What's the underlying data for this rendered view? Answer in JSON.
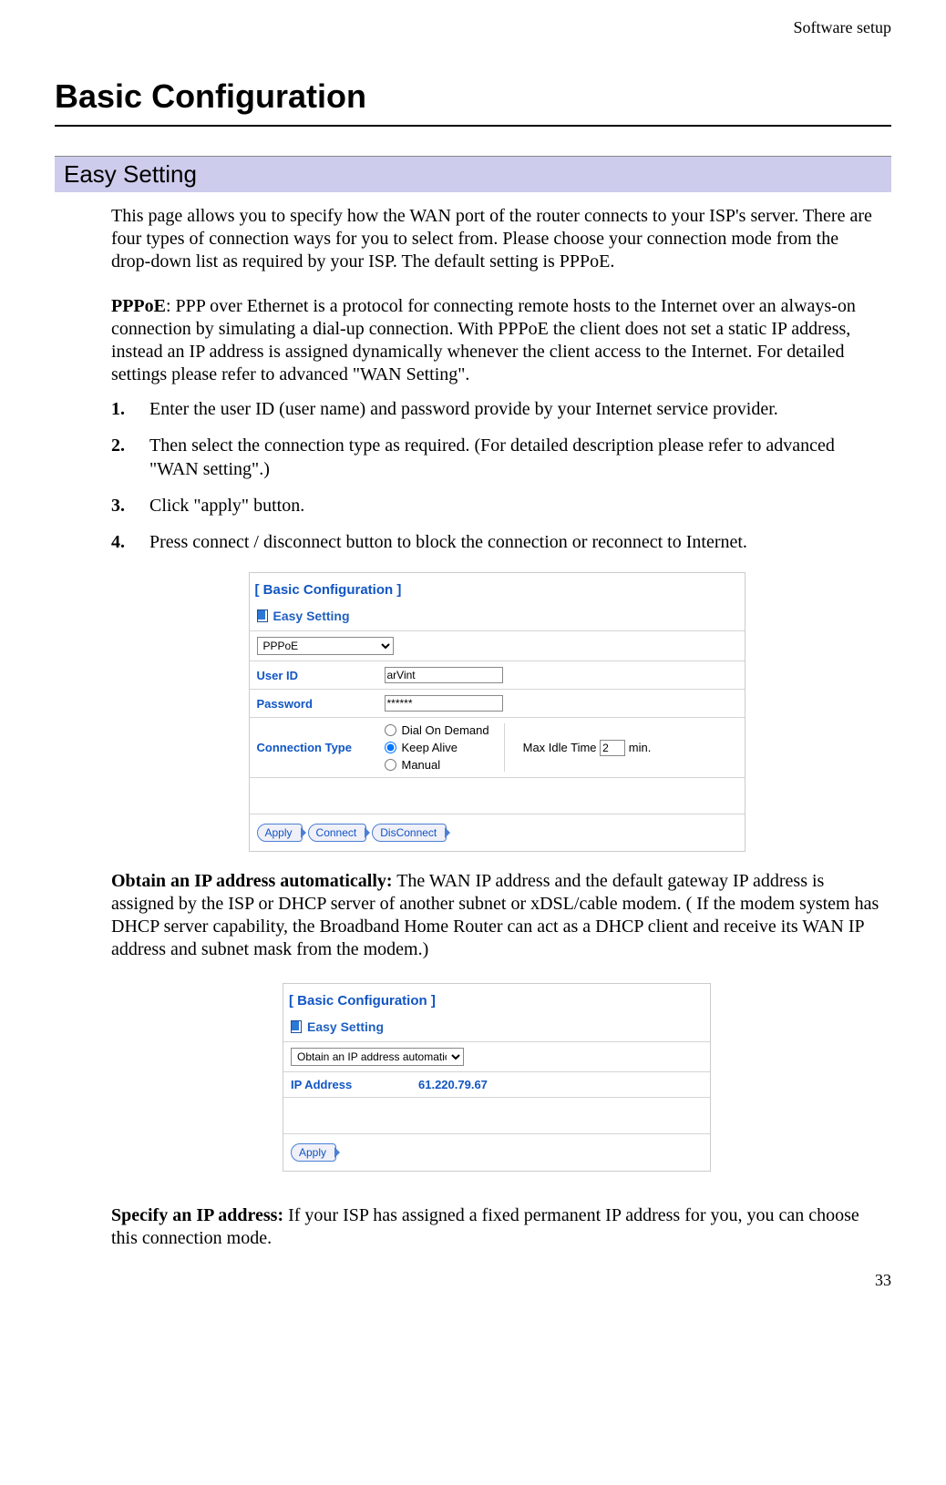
{
  "header": {
    "running_head": "Software setup",
    "title": "Basic Configuration",
    "section": "Easy Setting"
  },
  "intro": "This page allows you to specify how the WAN port of the router connects to your ISP's server. There are four types of connection ways for you to select from. Please choose your connection mode from the drop-down list as required by your ISP. The default setting is PPPoE.",
  "pppoe": {
    "label": "PPPoE",
    "desc": ": PPP over Ethernet is a protocol for connecting remote hosts to the Internet over an always-on connection by simulating a dial-up connection. With PPPoE the client does not set a static IP address, instead an IP address is assigned dynamically whenever the client access to the Internet. For detailed settings please refer to advanced \"WAN Setting\"."
  },
  "steps": [
    "Enter the user ID (user name) and password provide by your Internet service provider.",
    "Then select the connection type as required. (For detailed description please refer to advanced \"WAN setting\".)",
    "Click \"apply\" button.",
    "Press connect / disconnect button to block the connection or reconnect to Internet."
  ],
  "shot1": {
    "header": "[ Basic Configuration ]",
    "subheader": "Easy Setting",
    "select_value": "PPPoE",
    "user_id_label": "User ID",
    "user_id_value": "arVint",
    "password_label": "Password",
    "password_value": "******",
    "conn_type_label": "Connection Type",
    "radios": {
      "dial": "Dial On Demand",
      "keep": "Keep Alive",
      "manual": "Manual"
    },
    "idle_label_pre": "Max Idle Time ",
    "idle_value": "2",
    "idle_label_post": " min.",
    "buttons": {
      "apply": "Apply",
      "connect": "Connect",
      "disconnect": "DisConnect"
    }
  },
  "obtain": {
    "label": "Obtain an IP address automatically:",
    "desc": " The WAN IP address and the default gateway IP address is assigned by the ISP or DHCP server of another subnet or xDSL/cable modem. ( If the modem system has DHCP server capability, the Broadband Home Router can act as a DHCP client and receive its WAN IP address and subnet mask from the modem.)"
  },
  "shot2": {
    "header": "[ Basic Configuration ]",
    "subheader": "Easy Setting",
    "select_value": "Obtain an IP address automatically",
    "ip_label": "IP Address",
    "ip_value": "61.220.79.67",
    "button_apply": "Apply"
  },
  "specify": {
    "label": "Specify an IP address:",
    "desc": " If your ISP has assigned a fixed permanent IP address for you, you can choose this connection mode."
  },
  "page_number": "33"
}
